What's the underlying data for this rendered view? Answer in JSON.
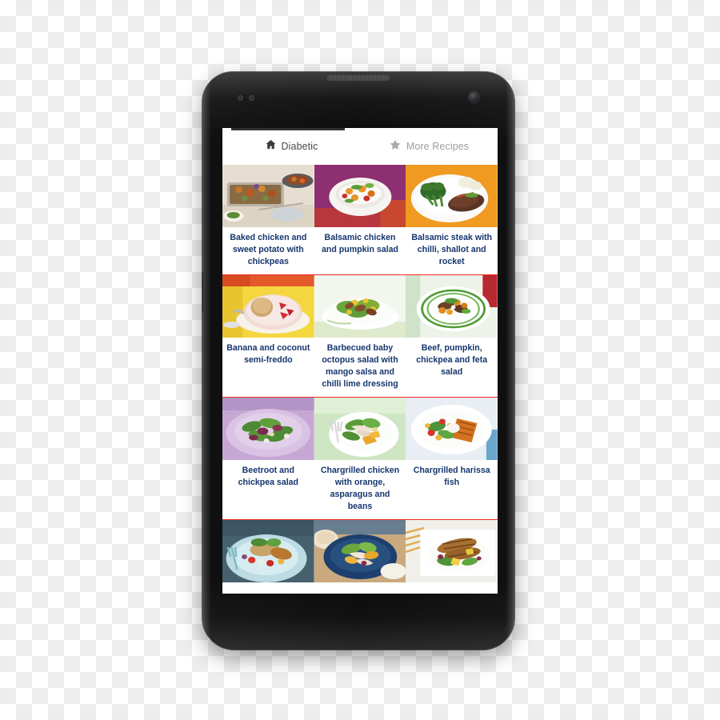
{
  "device": {
    "name": "android-phone-mockup",
    "body_color": "#0a0a0b",
    "screen_bg": "#ffffff"
  },
  "app": {
    "name": "Diabetic Recipes",
    "accent_divider_color": "#f02a21",
    "title_color": "#16356e"
  },
  "tabs": [
    {
      "label": "Diabetic",
      "icon": "home-icon",
      "active": true
    },
    {
      "label": "More Recipes",
      "icon": "star-icon",
      "active": false
    }
  ],
  "grid": {
    "columns": 3,
    "rows": [
      {
        "cells": [
          {
            "title": "Baked chicken and sweet potato with chickpeas",
            "image": "roasted-vegetable-tray-bake",
            "palette": {
              "bg": "#e6dfd1",
              "plate": "#cfc8bb",
              "food": "#c4762c",
              "accent": "#6f8f3f"
            }
          },
          {
            "title": "Balsamic chicken and pumpkin salad",
            "image": "white-bowl-pumpkin-salad-purple-backdrop",
            "palette": {
              "bg": "#8e2f72",
              "plate": "#f6f4f1",
              "food": "#e8962c",
              "accent": "#5f9c3a"
            }
          },
          {
            "title": "Balsamic steak with chilli, shallot and rocket",
            "image": "steak-with-broccolini-orange-backdrop",
            "palette": {
              "bg": "#f09a22",
              "plate": "#fbfaf8",
              "food": "#5a3526",
              "accent": "#3f7a2c"
            }
          }
        ]
      },
      {
        "cells": [
          {
            "title": "Banana and coconut semi-freddo",
            "image": "semi-freddo-with-strawberries-yellow-backdrop",
            "palette": {
              "bg": "#f4d63f",
              "plate": "#f7f3ea",
              "food": "#cfa66e",
              "accent": "#d6263c"
            }
          },
          {
            "title": "Barbecued baby octopus salad with mango salsa and chilli lime dressing",
            "image": "octopus-salad-white-plate",
            "palette": {
              "bg": "#f3f6ef",
              "plate": "#ffffff",
              "food": "#8a4b2c",
              "accent": "#7fae39"
            }
          },
          {
            "title": "Beef, pumpkin, chickpea and feta salad",
            "image": "beef-pumpkin-salad-green-striped-plate",
            "palette": {
              "bg": "#eef3ea",
              "plate": "#ffffff",
              "food": "#e08a22",
              "accent": "#4f9b33"
            }
          }
        ]
      },
      {
        "cells": [
          {
            "title": "Beetroot and chickpea salad",
            "image": "beetroot-salad-purple-plate",
            "palette": {
              "bg": "#c6a7d4",
              "plate": "#d9c2e4",
              "food": "#7d2a4b",
              "accent": "#4c8b34"
            }
          },
          {
            "title": "Chargrilled chicken with orange, asparagus and beans",
            "image": "chargrilled-chicken-orange-salad-mint-backdrop",
            "palette": {
              "bg": "#cfe6c4",
              "plate": "#ffffff",
              "food": "#e9a62c",
              "accent": "#5a9c38"
            }
          },
          {
            "title": "Chargrilled harissa fish",
            "image": "harissa-fish-white-plate",
            "palette": {
              "bg": "#e8eef4",
              "plate": "#ffffff",
              "food": "#d4731f",
              "accent": "#4f9338"
            }
          }
        ]
      },
      {
        "partial": true,
        "cells": [
          {
            "title": "",
            "image": "fish-salad-teal-plate",
            "palette": {
              "bg": "#46606e",
              "plate": "#bcdbe3",
              "food": "#b8782f",
              "accent": "#4e8b36"
            }
          },
          {
            "title": "",
            "image": "chicken-salad-blue-bowl",
            "palette": {
              "bg": "#c9a97d",
              "plate": "#1d3f6e",
              "food": "#e8a82c",
              "accent": "#6aa63c"
            }
          },
          {
            "title": "",
            "image": "chargrilled-chicken-white-platter",
            "palette": {
              "bg": "#f0efe9",
              "plate": "#ffffff",
              "food": "#a8702f",
              "accent": "#4f9338"
            }
          }
        ]
      }
    ]
  }
}
